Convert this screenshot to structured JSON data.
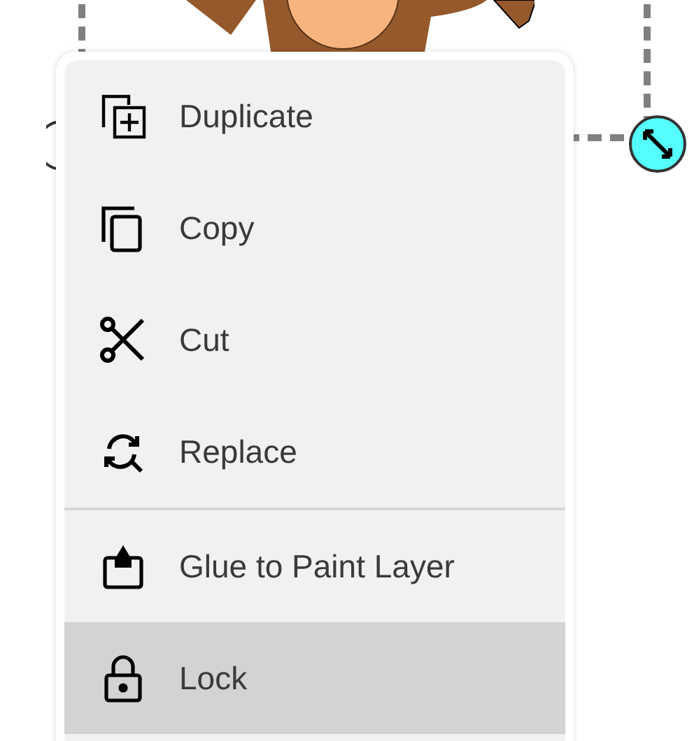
{
  "context_menu": {
    "groups": [
      {
        "items": [
          {
            "label": "Duplicate",
            "selected": false
          },
          {
            "label": "Copy",
            "selected": false
          },
          {
            "label": "Cut",
            "selected": false
          },
          {
            "label": "Replace",
            "selected": false
          }
        ]
      },
      {
        "items": [
          {
            "label": "Glue to Paint Layer",
            "selected": false
          },
          {
            "label": "Lock",
            "selected": true
          }
        ]
      }
    ]
  }
}
